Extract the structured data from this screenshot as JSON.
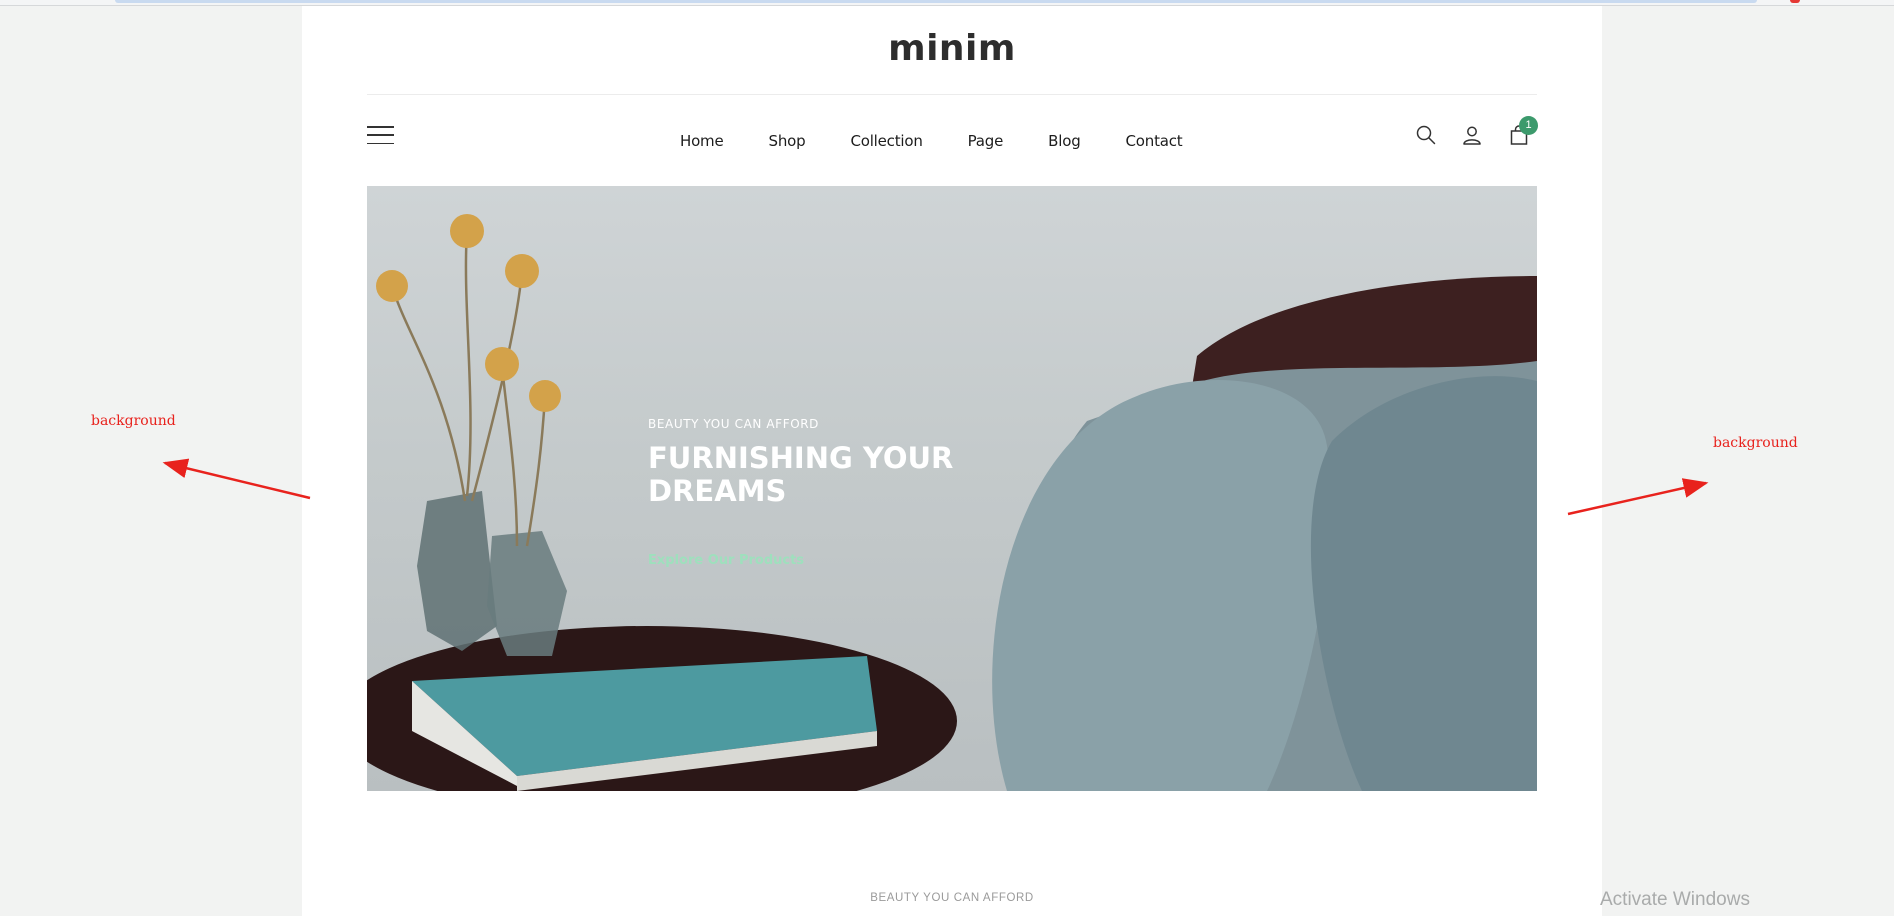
{
  "brand": {
    "logo_text": "minim"
  },
  "nav": {
    "items": [
      "Home",
      "Shop",
      "Collection",
      "Page",
      "Blog",
      "Contact"
    ]
  },
  "header_icons": [
    "menu-icon",
    "search-icon",
    "user-icon",
    "cart-icon"
  ],
  "cart": {
    "count": "1"
  },
  "hero": {
    "eyebrow": "BEAUTY YOU CAN AFFORD",
    "headline": "FURNISHING YOUR DREAMS",
    "cta_label": "Explore Our Products"
  },
  "section": {
    "eyebrow": "BEAUTY YOU CAN AFFORD"
  },
  "annotations": {
    "left_label": "background",
    "right_label": "background"
  },
  "system": {
    "watermark": "Activate Windows"
  },
  "colors": {
    "accent": "#3c9a6c",
    "cta": "#9ee0bd",
    "annotation": "#e8221d",
    "outer_background": "#f2f3f2"
  }
}
